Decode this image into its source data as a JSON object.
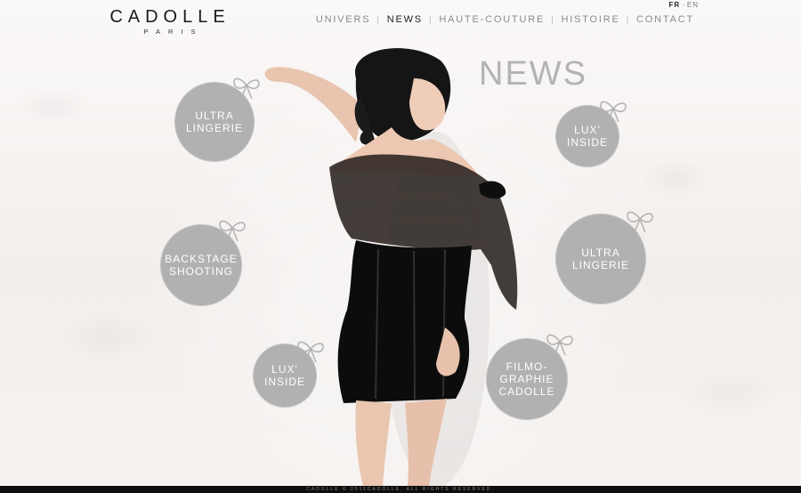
{
  "brand": {
    "name": "CADOLLE",
    "city": "PARIS"
  },
  "language": {
    "active": "FR",
    "separator": "-",
    "other": "EN"
  },
  "nav": {
    "items": [
      "UNIVERS",
      "NEWS",
      "HAUTE-COUTURE",
      "HISTOIRE",
      "CONTACT"
    ],
    "active": "NEWS"
  },
  "page": {
    "title": "NEWS"
  },
  "bubbles": [
    {
      "label": "ULTRA\nLINGERIE"
    },
    {
      "label": "BACKSTAGE\nSHOOTING"
    },
    {
      "label": "LUX'\nINSIDE"
    },
    {
      "label": "LUX'\nINSIDE"
    },
    {
      "label": "ULTRA\nLINGERIE"
    },
    {
      "label": "FILMO-\nGRAPHIE\nCADOLLE"
    }
  ],
  "footer": {
    "text": "CADOLLE © 2011CADOLLE. ALL RIGHTS RESERVED."
  },
  "colors": {
    "bubble": "#b1b1b1",
    "nav_active": "#222222",
    "nav": "#8a8a8a",
    "heading": "#b3b3b3",
    "footer_bg": "#0e0e0e"
  }
}
